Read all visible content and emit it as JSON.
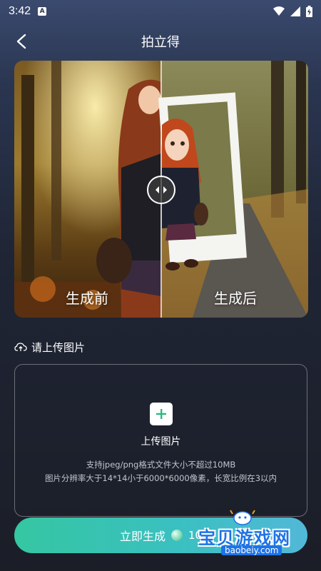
{
  "status_bar": {
    "time": "3:42",
    "notification_icon": "a-badge-icon",
    "wifi_icon": "wifi-icon",
    "signal_icon": "signal-icon",
    "battery_icon": "battery-charging-icon"
  },
  "header": {
    "title": "拍立得",
    "back_icon": "chevron-left-icon"
  },
  "comparison": {
    "before_label": "生成前",
    "after_label": "生成后",
    "handle_icon": "compare-slider-icon"
  },
  "upload": {
    "heading": "请上传图片",
    "heading_icon": "cloud-upload-icon",
    "add_icon": "plus-icon",
    "add_label": "上传图片",
    "hint_line1": "支持jpeg/png格式文件大小不超过10MB",
    "hint_line2": "图片分辨率大于14*14小于6000*6000像素，长宽比例在3以内"
  },
  "action": {
    "generate_label": "立即生成",
    "coin_icon": "coin-icon",
    "cost": "10"
  },
  "watermark": {
    "text": "宝贝游戏网",
    "url": "baobeiy.com"
  },
  "colors": {
    "accent_gradient_start": "#35c6a2",
    "accent_gradient_end": "#52b8d8",
    "plus_green": "#2fb67f",
    "watermark_blue": "#1f73e6"
  }
}
